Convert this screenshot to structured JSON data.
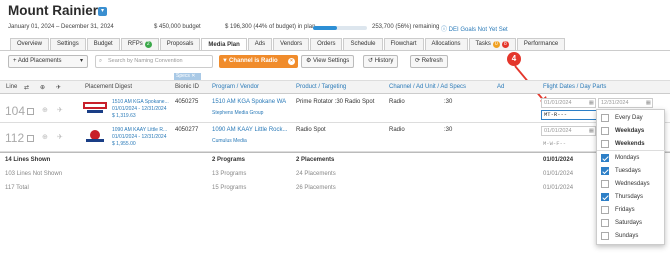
{
  "header": {
    "title": "Mount Rainier",
    "dates": "January 01, 2024 – December 31, 2024",
    "budget": "$ 450,000 budget",
    "in_plan": "$ 196,300 (44% of budget) in plan",
    "remaining": "253,700 (56%) remaining",
    "dei_link": "DEI Goals Not Yet Set",
    "progress_fraction": 0.44
  },
  "tabs": [
    {
      "label": "Overview"
    },
    {
      "label": "Settings"
    },
    {
      "label": "Budget"
    },
    {
      "label": "RFPs",
      "badge": "2"
    },
    {
      "label": "Proposals"
    },
    {
      "label": "Media Plan",
      "active": true
    },
    {
      "label": "Ads"
    },
    {
      "label": "Vendors"
    },
    {
      "label": "Orders"
    },
    {
      "label": "Schedule"
    },
    {
      "label": "Flowchart"
    },
    {
      "label": "Allocations"
    },
    {
      "label": "Tasks",
      "badges": [
        "0",
        "8"
      ]
    },
    {
      "label": "Performance"
    }
  ],
  "toolbar": {
    "add_placements": "+ Add Placements",
    "search_placeholder": "Search by Naming Convention",
    "channel_filter": "Channel is Radio",
    "view_settings": "View Settings",
    "history": "History",
    "refresh": "Refresh"
  },
  "specs_tag": "Specs",
  "columns": {
    "line": "Line",
    "placement_digest": "Placement Digest",
    "bionic_id": "Bionic ID",
    "program_vendor": "Program / Vendor",
    "product_targeting": "Product / Targeting",
    "channel": "Channel / Ad Unit / Ad Specs",
    "ad": "Ad",
    "flight_dates": "Flight Dates / Day Parts"
  },
  "rows": [
    {
      "line": "104",
      "digest_title": "1510 AM KGA Spokane...",
      "digest_dates": "01/01/2024 - 12/31/2024",
      "digest_amount": "$ 1,319.63",
      "bionic_id": "4050275",
      "program": "1510 AM KGA Spokane WA",
      "vendor": "Stephens Media Group",
      "product": "Prime Rotator :30 Radio Spot",
      "channel": "Radio",
      "specs": ":30",
      "start_placeholder": "01/01/2024",
      "end_placeholder": "12/31/2024",
      "dayparts": "MT-R---"
    },
    {
      "line": "112",
      "digest_title": "1090 AM KAAY Little R...",
      "digest_dates": "01/01/2024 - 12/31/2024",
      "digest_amount": "$ 1,955.00",
      "bionic_id": "4050277",
      "program": "1090 AM KAAY Little Rock...",
      "vendor": "Cumulus Media",
      "product": "Radio Spot",
      "channel": "Radio",
      "specs": ":30",
      "start_placeholder": "01/01/2024",
      "dayparts": "M-W-F--"
    }
  ],
  "footer": {
    "shown": "14 Lines Shown",
    "not_shown": "103 Lines Not Shown",
    "total": "117 Total",
    "shown_programs": "2 Programs",
    "not_shown_programs": "13 Programs",
    "total_programs": "15 Programs",
    "shown_placements": "2 Placements",
    "not_shown_placements": "24 Placements",
    "total_placements": "26 Placements",
    "shown_date": "01/01/2024",
    "not_shown_date": "01/01/2024",
    "total_date": "01/01/2024"
  },
  "dayparts_menu": [
    {
      "label": "Every Day",
      "checked": false
    },
    {
      "label": "Weekdays",
      "checked": false
    },
    {
      "label": "Weekends",
      "checked": false
    },
    {
      "label": "Mondays",
      "checked": true
    },
    {
      "label": "Tuesdays",
      "checked": true
    },
    {
      "label": "Wednesdays",
      "checked": false
    },
    {
      "label": "Thursdays",
      "checked": true
    },
    {
      "label": "Fridays",
      "checked": false
    },
    {
      "label": "Saturdays",
      "checked": false
    },
    {
      "label": "Sundays",
      "checked": false
    }
  ],
  "annotation": {
    "marker": "4"
  },
  "colors": {
    "accent": "#2d7fc7",
    "orange": "#f08c2c",
    "marker": "#e4362b"
  }
}
